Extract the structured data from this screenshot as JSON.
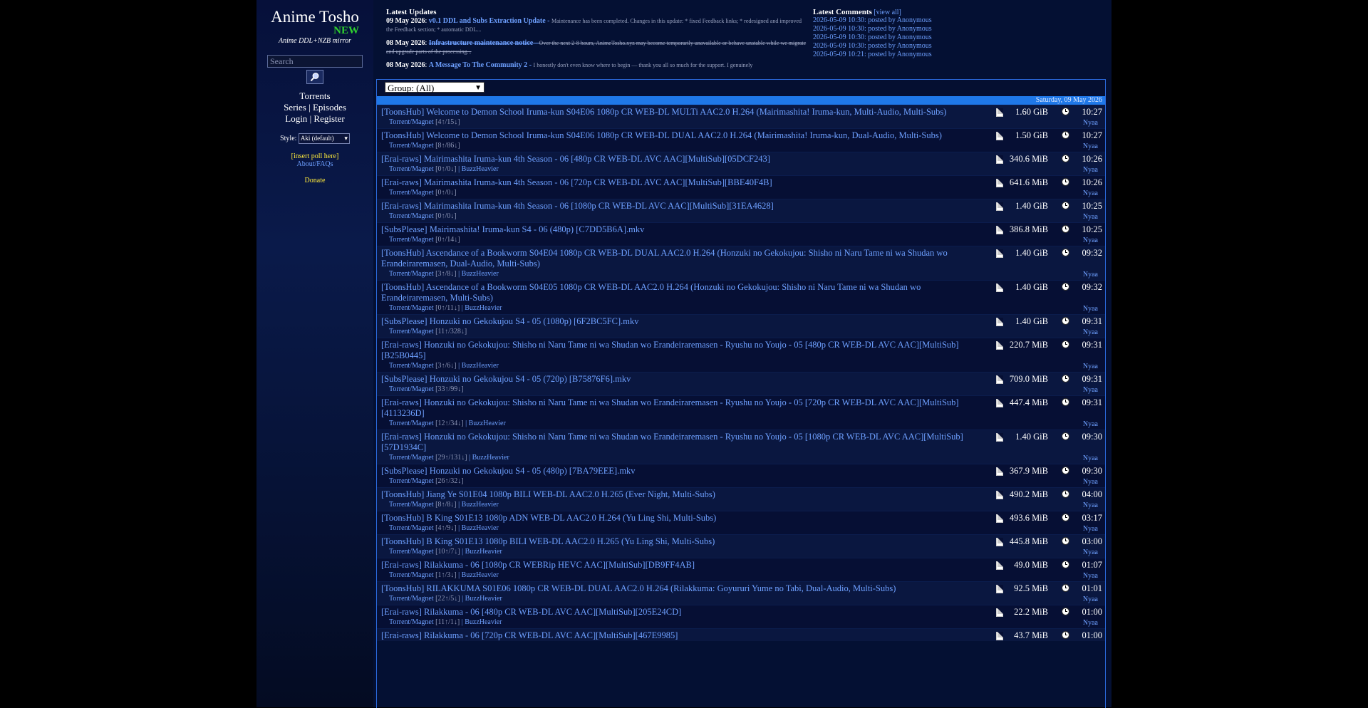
{
  "sidebar": {
    "title": "Anime Tosho",
    "new_badge": "NEW",
    "subtitle": "Anime DDL+NZB mirror",
    "search_placeholder": "Search",
    "nav": {
      "torrents": "Torrents",
      "series": "Series",
      "episodes": "Episodes",
      "login": "Login",
      "register": "Register",
      "sep": "|"
    },
    "style_label": "Style:",
    "style_value": "Aki (default)",
    "poll": "[insert poll here]",
    "about": "About/FAQs",
    "donate": "Donate"
  },
  "updates": {
    "heading": "Latest Updates",
    "items": [
      {
        "date": "09 May 2026",
        "title": "v0.1 DDL and Subs Extraction Update",
        "excerpt": "Maintenance has been completed. Changes in this update: * fixed Feedback links; * redesigned and improved the Feedback section; * automatic DDL..."
      },
      {
        "date": "08 May 2026",
        "title": "Infrastructure maintenance notice",
        "excerpt": "Over the next 2-8 hours, AnimeTosho.xyz may become temporarily unavailable or behave unstable while we migrate and upgrade parts of the processing..."
      },
      {
        "date": "08 May 2026",
        "title": "A Message To The Community 2",
        "excerpt": "I honestly don't even know where to begin — thank you all so much for the support. I genuinely"
      }
    ]
  },
  "comments": {
    "heading": "Latest Comments",
    "view_all": "[view all]",
    "items": [
      "2026-05-09 10:30: posted by Anonymous",
      "2026-05-09 10:30: posted by Anonymous",
      "2026-05-09 10:30: posted by Anonymous",
      "2026-05-09 10:30: posted by Anonymous",
      "2026-05-09 10:21: posted by Anonymous"
    ]
  },
  "list": {
    "group_select": "Group: (All)",
    "date": "Saturday, 09 May 2026",
    "torrent_label": "Torrent",
    "magnet_label": "Magnet",
    "rows": [
      {
        "title": "[ToonsHub] Welcome to Demon School Iruma-kun S04E06 1080p CR WEB-DL MULTi AAC2.0 H.264 (Mairimashita! Iruma-kun, Multi-Audio, Multi-Subs)",
        "stats": "[4↑/15↓]",
        "extra": "",
        "size": "1.60 GiB",
        "time": "10:27",
        "source": "Nyaa"
      },
      {
        "title": "[ToonsHub] Welcome to Demon School Iruma-kun S04E06 1080p CR WEB-DL DUAL AAC2.0 H.264 (Mairimashita! Iruma-kun, Dual-Audio, Multi-Subs)",
        "stats": "[8↑/86↓]",
        "extra": "",
        "size": "1.50 GiB",
        "time": "10:27",
        "source": "Nyaa"
      },
      {
        "title": "[Erai-raws] Mairimashita Iruma-kun 4th Season - 06 [480p CR WEB-DL AVC AAC][MultiSub][05DCF243]",
        "stats": "[0↑/0↓]",
        "extra": "BuzzHeavier",
        "size": "340.6 MiB",
        "time": "10:26",
        "source": "Nyaa"
      },
      {
        "title": "[Erai-raws] Mairimashita Iruma-kun 4th Season - 06 [720p CR WEB-DL AVC AAC][MultiSub][BBE40F4B]",
        "stats": "[0↑/0↓]",
        "extra": "",
        "size": "641.6 MiB",
        "time": "10:26",
        "source": "Nyaa"
      },
      {
        "title": "[Erai-raws] Mairimashita Iruma-kun 4th Season - 06 [1080p CR WEB-DL AVC AAC][MultiSub][31EA4628]",
        "stats": "[0↑/0↓]",
        "extra": "",
        "size": "1.40 GiB",
        "time": "10:25",
        "source": "Nyaa"
      },
      {
        "title": "[SubsPlease] Mairimashita! Iruma-kun S4 - 06 (480p) [C7DD5B6A].mkv",
        "stats": "[0↑/14↓]",
        "extra": "",
        "size": "386.8 MiB",
        "time": "10:25",
        "source": "Nyaa"
      },
      {
        "title": "[ToonsHub] Ascendance of a Bookworm S04E04 1080p CR WEB-DL DUAL AAC2.0 H.264 (Honzuki no Gekokujou: Shisho ni Naru Tame ni wa Shudan wo Erandeiraremasen, Dual-Audio, Multi-Subs)",
        "stats": "[3↑/8↓]",
        "extra": "BuzzHeavier",
        "size": "1.40 GiB",
        "time": "09:32",
        "source": "Nyaa"
      },
      {
        "title": "[ToonsHub] Ascendance of a Bookworm S04E05 1080p CR WEB-DL AAC2.0 H.264 (Honzuki no Gekokujou: Shisho ni Naru Tame ni wa Shudan wo Erandeiraremasen, Multi-Subs)",
        "stats": "[0↑/11↓]",
        "extra": "BuzzHeavier",
        "size": "1.40 GiB",
        "time": "09:32",
        "source": "Nyaa"
      },
      {
        "title": "[SubsPlease] Honzuki no Gekokujou S4 - 05 (1080p) [6F2BC5FC].mkv",
        "stats": "[11↑/328↓]",
        "extra": "",
        "size": "1.40 GiB",
        "time": "09:31",
        "source": "Nyaa"
      },
      {
        "title": "[Erai-raws] Honzuki no Gekokujou: Shisho ni Naru Tame ni wa Shudan wo Erandeiraremasen - Ryushu no Youjo - 05 [480p CR WEB-DL AVC AAC][MultiSub][B25B0445]",
        "stats": "[3↑/6↓]",
        "extra": "BuzzHeavier",
        "size": "220.7 MiB",
        "time": "09:31",
        "source": "Nyaa"
      },
      {
        "title": "[SubsPlease] Honzuki no Gekokujou S4 - 05 (720p) [B75876F6].mkv",
        "stats": "[33↑/99↓]",
        "extra": "",
        "size": "709.0 MiB",
        "time": "09:31",
        "source": "Nyaa"
      },
      {
        "title": "[Erai-raws] Honzuki no Gekokujou: Shisho ni Naru Tame ni wa Shudan wo Erandeiraremasen - Ryushu no Youjo - 05 [720p CR WEB-DL AVC AAC][MultiSub][4113236D]",
        "stats": "[12↑/34↓]",
        "extra": "BuzzHeavier",
        "size": "447.4 MiB",
        "time": "09:31",
        "source": "Nyaa"
      },
      {
        "title": "[Erai-raws] Honzuki no Gekokujou: Shisho ni Naru Tame ni wa Shudan wo Erandeiraremasen - Ryushu no Youjo - 05 [1080p CR WEB-DL AVC AAC][MultiSub][57D1934C]",
        "stats": "[29↑/131↓]",
        "extra": "BuzzHeavier",
        "size": "1.40 GiB",
        "time": "09:30",
        "source": "Nyaa"
      },
      {
        "title": "[SubsPlease] Honzuki no Gekokujou S4 - 05 (480p) [7BA79EEE].mkv",
        "stats": "[26↑/32↓]",
        "extra": "",
        "size": "367.9 MiB",
        "time": "09:30",
        "source": "Nyaa"
      },
      {
        "title": "[ToonsHub] Jiang Ye S01E04 1080p BILI WEB-DL AAC2.0 H.265 (Ever Night, Multi-Subs)",
        "stats": "[8↑/8↓]",
        "extra": "BuzzHeavier",
        "size": "490.2 MiB",
        "time": "04:00",
        "source": "Nyaa"
      },
      {
        "title": "[ToonsHub] B King S01E13 1080p ADN WEB-DL AAC2.0 H.264 (Yu Ling Shi, Multi-Subs)",
        "stats": "[4↑/9↓]",
        "extra": "BuzzHeavier",
        "size": "493.6 MiB",
        "time": "03:17",
        "source": "Nyaa"
      },
      {
        "title": "[ToonsHub] B King S01E13 1080p BILI WEB-DL AAC2.0 H.265 (Yu Ling Shi, Multi-Subs)",
        "stats": "[10↑/7↓]",
        "extra": "BuzzHeavier",
        "size": "445.8 MiB",
        "time": "03:00",
        "source": "Nyaa"
      },
      {
        "title": "[Erai-raws] Rilakkuma - 06 [1080p CR WEBRip HEVC AAC][MultiSub][DB9FF4AB]",
        "stats": "[1↑/3↓]",
        "extra": "BuzzHeavier",
        "size": "49.0 MiB",
        "time": "01:07",
        "source": "Nyaa"
      },
      {
        "title": "[ToonsHub] RILAKKUMA S01E06 1080p CR WEB-DL DUAL AAC2.0 H.264 (Rilakkuma: Goyururi Yume no Tabi, Dual-Audio, Multi-Subs)",
        "stats": "[22↑/5↓]",
        "extra": "BuzzHeavier",
        "size": "92.5 MiB",
        "time": "01:01",
        "source": "Nyaa"
      },
      {
        "title": "[Erai-raws] Rilakkuma - 06 [480p CR WEB-DL AVC AAC][MultiSub][205E24CD]",
        "stats": "[11↑/1↓]",
        "extra": "BuzzHeavier",
        "size": "22.2 MiB",
        "time": "01:00",
        "source": "Nyaa"
      },
      {
        "title": "[Erai-raws] Rilakkuma - 06 [720p CR WEB-DL AVC AAC][MultiSub][467E9985]",
        "stats": "",
        "extra": "",
        "size": "43.7 MiB",
        "time": "01:00",
        "source": ""
      }
    ]
  }
}
